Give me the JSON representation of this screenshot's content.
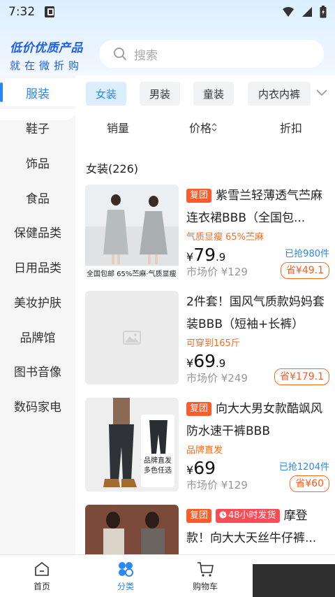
{
  "status_bar": {
    "time": "7:32"
  },
  "header": {
    "logo_line1": "低价优质产品",
    "logo_line2": "就在微折购",
    "search_placeholder": "搜索"
  },
  "sidebar": {
    "items": [
      "服装",
      "鞋子",
      "饰品",
      "食品",
      "保健品类",
      "日用品类",
      "美妆护肤",
      "品牌馆",
      "图书音像",
      "数码家电"
    ],
    "active": 0
  },
  "subcategories": {
    "items": [
      "女装",
      "男装",
      "童装",
      "内衣内裤"
    ],
    "active": 0
  },
  "sort_bar": {
    "sales": "销量",
    "price": "价格",
    "discount": "折扣"
  },
  "list_title": "女装(226)",
  "products": [
    {
      "tags": [
        "复团"
      ],
      "title": "紫雪兰轻薄透气苎麻连衣裙BBB（全国包...",
      "features": "气质显瘦   65%苎麻",
      "price_int": "79",
      "price_dec": ".9",
      "market": "市场价 ¥129",
      "sold": "已抢980件",
      "save": "省¥49.1",
      "image_caption": "全国包邮 65%苎麻·气质显瘦"
    },
    {
      "tags": [],
      "title": "2件套！国风气质款妈妈套装BBB（短袖+长裤）",
      "features": "可穿到165斤",
      "price_int": "69",
      "price_dec": ".9",
      "market": "市场价 ¥249",
      "sold": "",
      "save": "省¥179.1",
      "image_caption": ""
    },
    {
      "tags": [
        "复团"
      ],
      "title": "向大大男女款酷飒风防水速干裤BBB",
      "features": "品牌直发",
      "price_int": "69",
      "price_dec": "",
      "market": "市场价 ¥129",
      "sold": "已抢1204件",
      "save": "省¥60",
      "image_caption": "品牌直发 多色任选"
    },
    {
      "tags": [
        "复团",
        "48小时发货"
      ],
      "title": "摩登款！向大大天丝牛仔裤...",
      "features": "",
      "price_int": "",
      "price_dec": "",
      "market": "",
      "sold": "",
      "save": "",
      "image_caption": ""
    }
  ],
  "tabbar": {
    "items": [
      "首页",
      "分类",
      "购物车"
    ],
    "active": 1
  },
  "currency": "¥",
  "colors": {
    "accent": "#2b86f7",
    "orange": "#ff5a1a",
    "logo_blue": "#1e5ee8"
  },
  "icons": [
    "wifi-icon",
    "signal-icon",
    "battery-icon",
    "search-icon",
    "chevron-down-icon",
    "sort-arrows-icon",
    "home-icon",
    "category-icon",
    "cart-icon",
    "image-placeholder-icon",
    "clock-icon"
  ]
}
